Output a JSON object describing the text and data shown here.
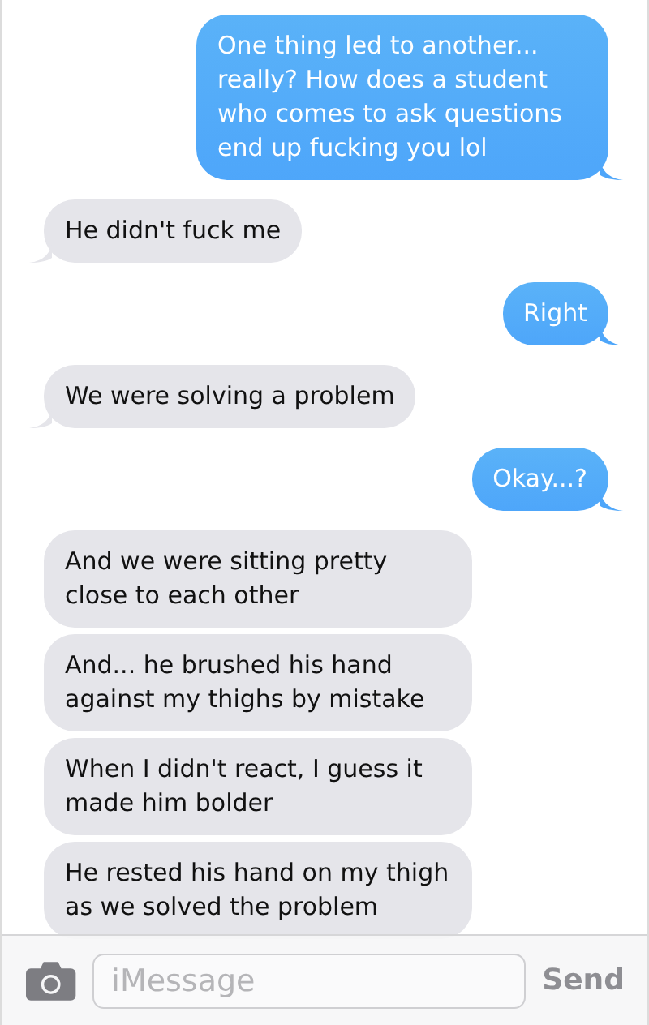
{
  "messages": [
    {
      "kind": "sent",
      "text": "One thing led to another... really? How does a student who comes to ask questions end up fucking you lol",
      "tail": true
    },
    {
      "kind": "received",
      "text": "He didn't fuck me",
      "tail": true
    },
    {
      "kind": "sent",
      "text": "Right",
      "tail": true
    },
    {
      "kind": "received",
      "text": "We were solving a problem",
      "tail": true
    },
    {
      "kind": "sent",
      "text": "Okay...?",
      "tail": true
    },
    {
      "kind": "received",
      "text": "And we were sitting pretty close to each other",
      "tail": false
    },
    {
      "kind": "received",
      "text": "And... he brushed his hand against my thighs by mistake",
      "tail": false
    },
    {
      "kind": "received",
      "text": "When I didn't react, I guess it made him bolder",
      "tail": false
    },
    {
      "kind": "received",
      "text": "He rested his hand on my thigh as we solved the problem",
      "tail": false
    }
  ],
  "composer": {
    "placeholder": "iMessage",
    "send": "Send"
  }
}
